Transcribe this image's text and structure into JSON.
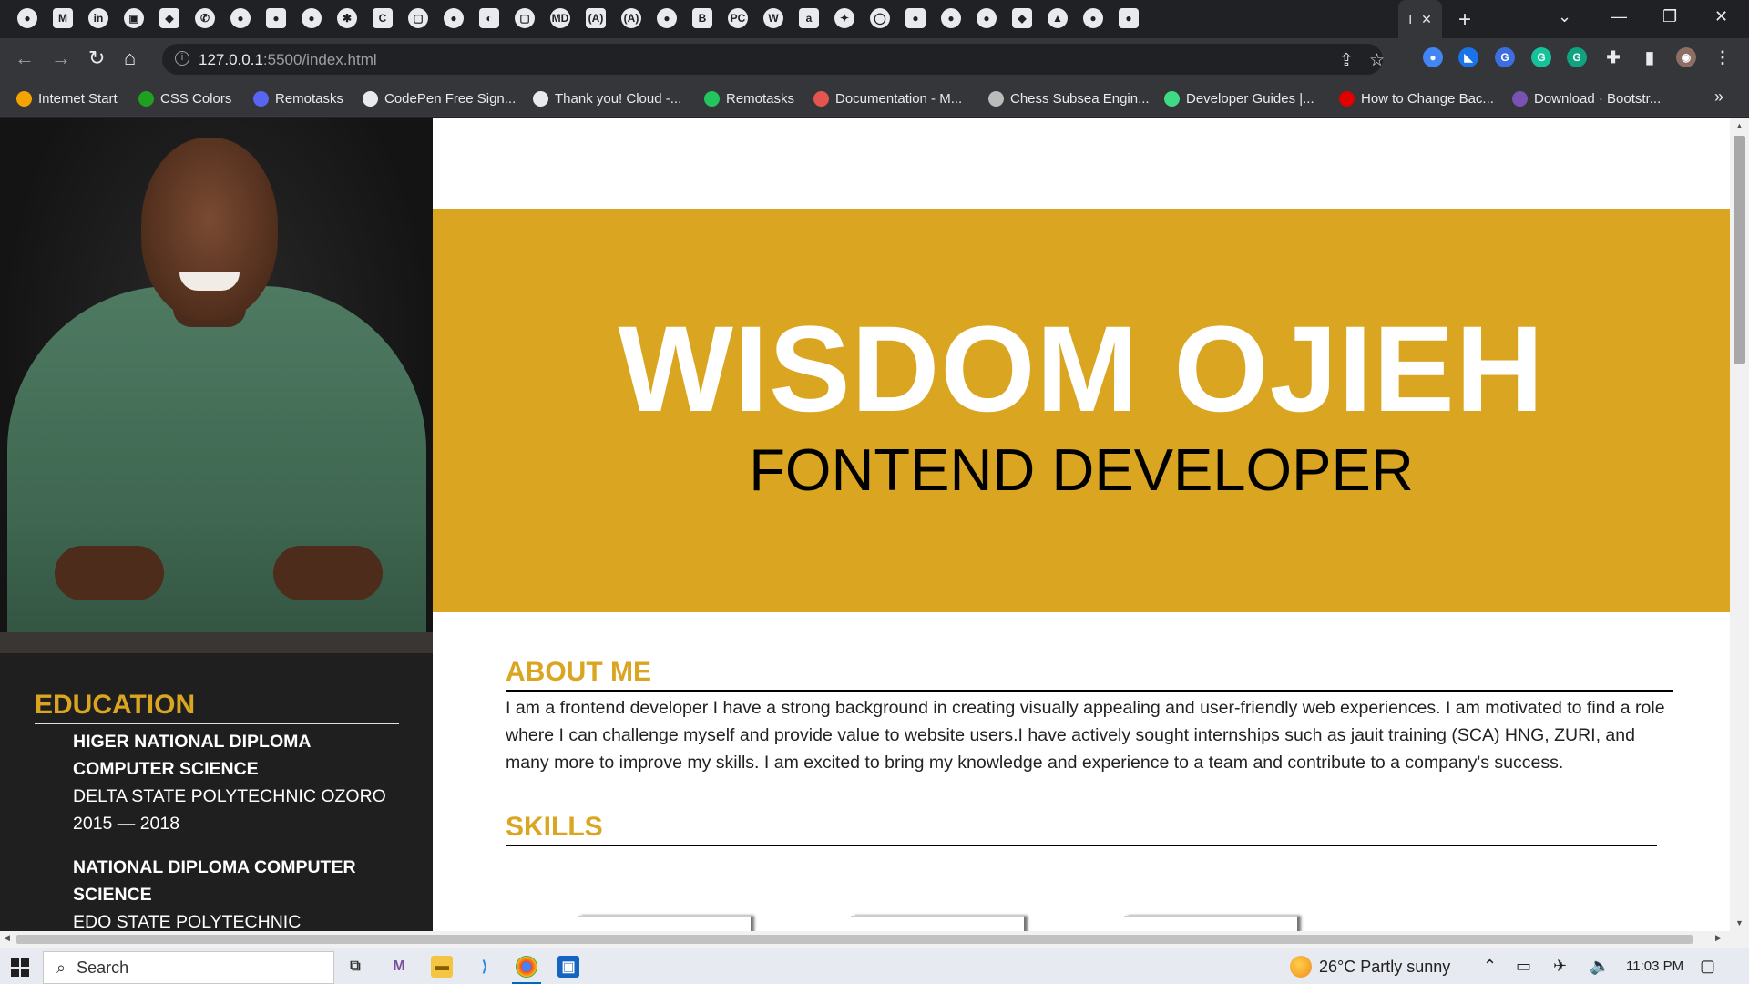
{
  "browser": {
    "active_tab_label": "I",
    "url_host": "127.0.0.1",
    "url_path": ":5500/index.html",
    "tab_icon_glyphs": [
      "●",
      "M",
      "in",
      "▣",
      "◆",
      "✆",
      "●",
      "●",
      "●",
      "✱",
      "C",
      "▢",
      "●",
      "◐",
      "▢",
      "MD",
      "(A)",
      "(A)",
      "●",
      "B",
      "PC",
      "W",
      "a",
      "✦",
      "◯",
      "●",
      "●",
      "●",
      "◆",
      "▲",
      "●",
      "●"
    ]
  },
  "bookmarks": [
    {
      "label": "Internet Start",
      "color": "#f4a300"
    },
    {
      "label": "CSS Colors",
      "color": "#20a020"
    },
    {
      "label": "Remotasks",
      "color": "#5865f2"
    },
    {
      "label": "CodePen Free Sign...",
      "color": "#e8eaed"
    },
    {
      "label": "Thank you! Cloud -...",
      "color": "#e8eaed"
    },
    {
      "label": "Remotasks",
      "color": "#22c55e"
    },
    {
      "label": "Documentation - M...",
      "color": "#e5554f"
    },
    {
      "label": "Chess Subsea Engin...",
      "color": "#bbbbbb"
    },
    {
      "label": "Developer Guides |...",
      "color": "#3ddc84"
    },
    {
      "label": "How to Change Bac...",
      "color": "#e00000"
    },
    {
      "label": "Download · Bootstr...",
      "color": "#7952b3"
    }
  ],
  "page": {
    "name": "WISDOM OJIEH",
    "role": "FONTEND DEVELOPER",
    "accent_color": "#daa520",
    "education": {
      "title": "EDUCATION",
      "entries": [
        {
          "degree": "HIGER NATIONAL DIPLOMA COMPUTER SCIENCE",
          "school": "DELTA STATE POLYTECHNIC OZORO 2015 — 2018"
        },
        {
          "degree": "NATIONAL DIPLOMA COMPUTER SCIENCE",
          "school": "EDO STATE POLYTECHNIC"
        }
      ]
    },
    "about": {
      "title": "ABOUT ME",
      "text": "I am a frontend developer I have a strong background in creating visually appealing and user-friendly web experiences. I am motivated to find a role where I can challenge myself and provide value to website users.I have actively sought internships such as jauit training (SCA) HNG, ZURI, and many more to improve my skills. I am excited to bring my knowledge and experience to a team and contribute to a company's success."
    },
    "skills": {
      "title": "SKILLS"
    }
  },
  "taskbar": {
    "search_label": "Search",
    "weather": "26°C  Partly sunny",
    "time": "11:03 PM"
  }
}
